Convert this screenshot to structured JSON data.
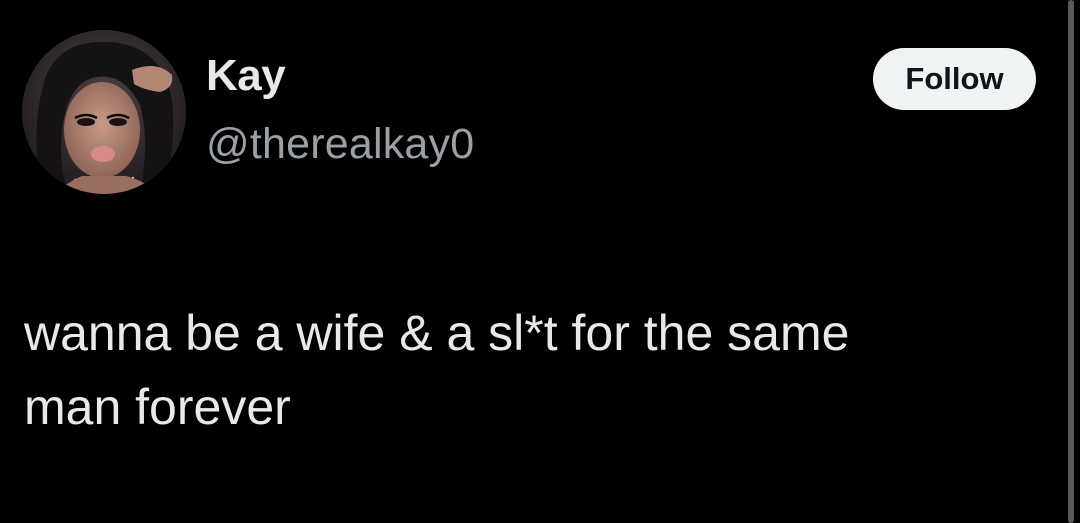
{
  "tweet": {
    "author": {
      "display_name": "Kay",
      "handle": "@therealkay0",
      "avatar_icon": "profile-photo"
    },
    "follow_label": "Follow",
    "text": "wanna be a wife & a sl*t for the same\nman forever"
  },
  "colors": {
    "background": "#000000",
    "primary_text": "#e7e9ea",
    "secondary_text": "#9aa0a6",
    "button_bg": "#eff3f4",
    "button_text": "#0f1419"
  }
}
